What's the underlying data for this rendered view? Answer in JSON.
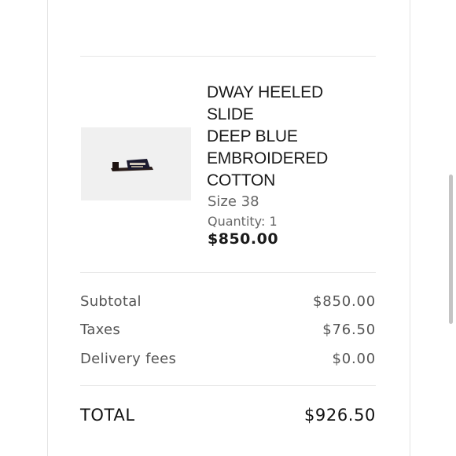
{
  "product": {
    "name_lines": [
      "DWAY HEELED",
      "SLIDE",
      "DEEP BLUE",
      "EMBROIDERED",
      "COTTON"
    ],
    "size": "Size 38",
    "quantity": "Quantity: 1",
    "price": "$850.00",
    "image_icon": "slide-sandal-icon"
  },
  "summary": {
    "subtotal_label": "Subtotal",
    "subtotal_value": "$850.00",
    "taxes_label": "Taxes",
    "taxes_value": "$76.50",
    "delivery_label": "Delivery fees",
    "delivery_value": "$0.00",
    "total_label": "TOTAL",
    "total_value": "$926.50"
  },
  "colors": {
    "text_primary": "#1a1a1a",
    "text_secondary": "#555555",
    "divider": "#e6e6e6",
    "image_bg": "#f0f0f0"
  }
}
